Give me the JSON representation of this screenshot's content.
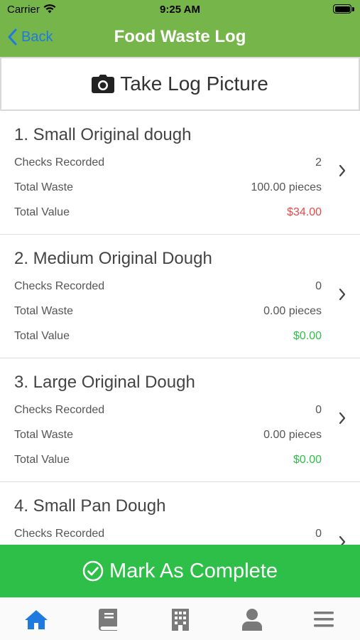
{
  "status_bar": {
    "carrier": "Carrier",
    "time": "9:25 AM"
  },
  "nav": {
    "back_label": "Back",
    "title": "Food Waste Log"
  },
  "photo_button": {
    "label": "Take Log Picture",
    "icon": "camera-icon"
  },
  "items": [
    {
      "title": "1. Small Original dough",
      "rows": [
        {
          "label": "Checks Recorded",
          "value": "2"
        },
        {
          "label": "Total Waste",
          "value": "100.00 pieces"
        },
        {
          "label": "Total Value",
          "value": "$34.00",
          "value_color": "#e64b4b"
        }
      ]
    },
    {
      "title": "2. Medium Original Dough",
      "rows": [
        {
          "label": "Checks Recorded",
          "value": "0"
        },
        {
          "label": "Total Waste",
          "value": "0.00 pieces"
        },
        {
          "label": "Total Value",
          "value": "$0.00",
          "value_color": "#2dbf48"
        }
      ]
    },
    {
      "title": "3. Large Original Dough",
      "rows": [
        {
          "label": "Checks Recorded",
          "value": "0"
        },
        {
          "label": "Total Waste",
          "value": "0.00 pieces"
        },
        {
          "label": "Total Value",
          "value": "$0.00",
          "value_color": "#2dbf48"
        }
      ]
    },
    {
      "title": "4. Small Pan Dough",
      "rows": [
        {
          "label": "Checks Recorded",
          "value": "0"
        }
      ]
    }
  ],
  "complete_button": {
    "label": "Mark As Complete",
    "icon": "check-circle-icon"
  },
  "tabs": [
    {
      "icon": "home-icon",
      "active": true
    },
    {
      "icon": "book-icon",
      "active": false
    },
    {
      "icon": "building-icon",
      "active": false
    },
    {
      "icon": "person-icon",
      "active": false
    },
    {
      "icon": "menu-icon",
      "active": false
    }
  ],
  "colors": {
    "header": "#76b54a",
    "back": "#1f7ae0",
    "complete": "#2dbf48",
    "loss": "#e64b4b",
    "zero": "#2dbf48",
    "tab_active": "#1f7ae0",
    "tab_inactive": "#7a7a7a"
  }
}
